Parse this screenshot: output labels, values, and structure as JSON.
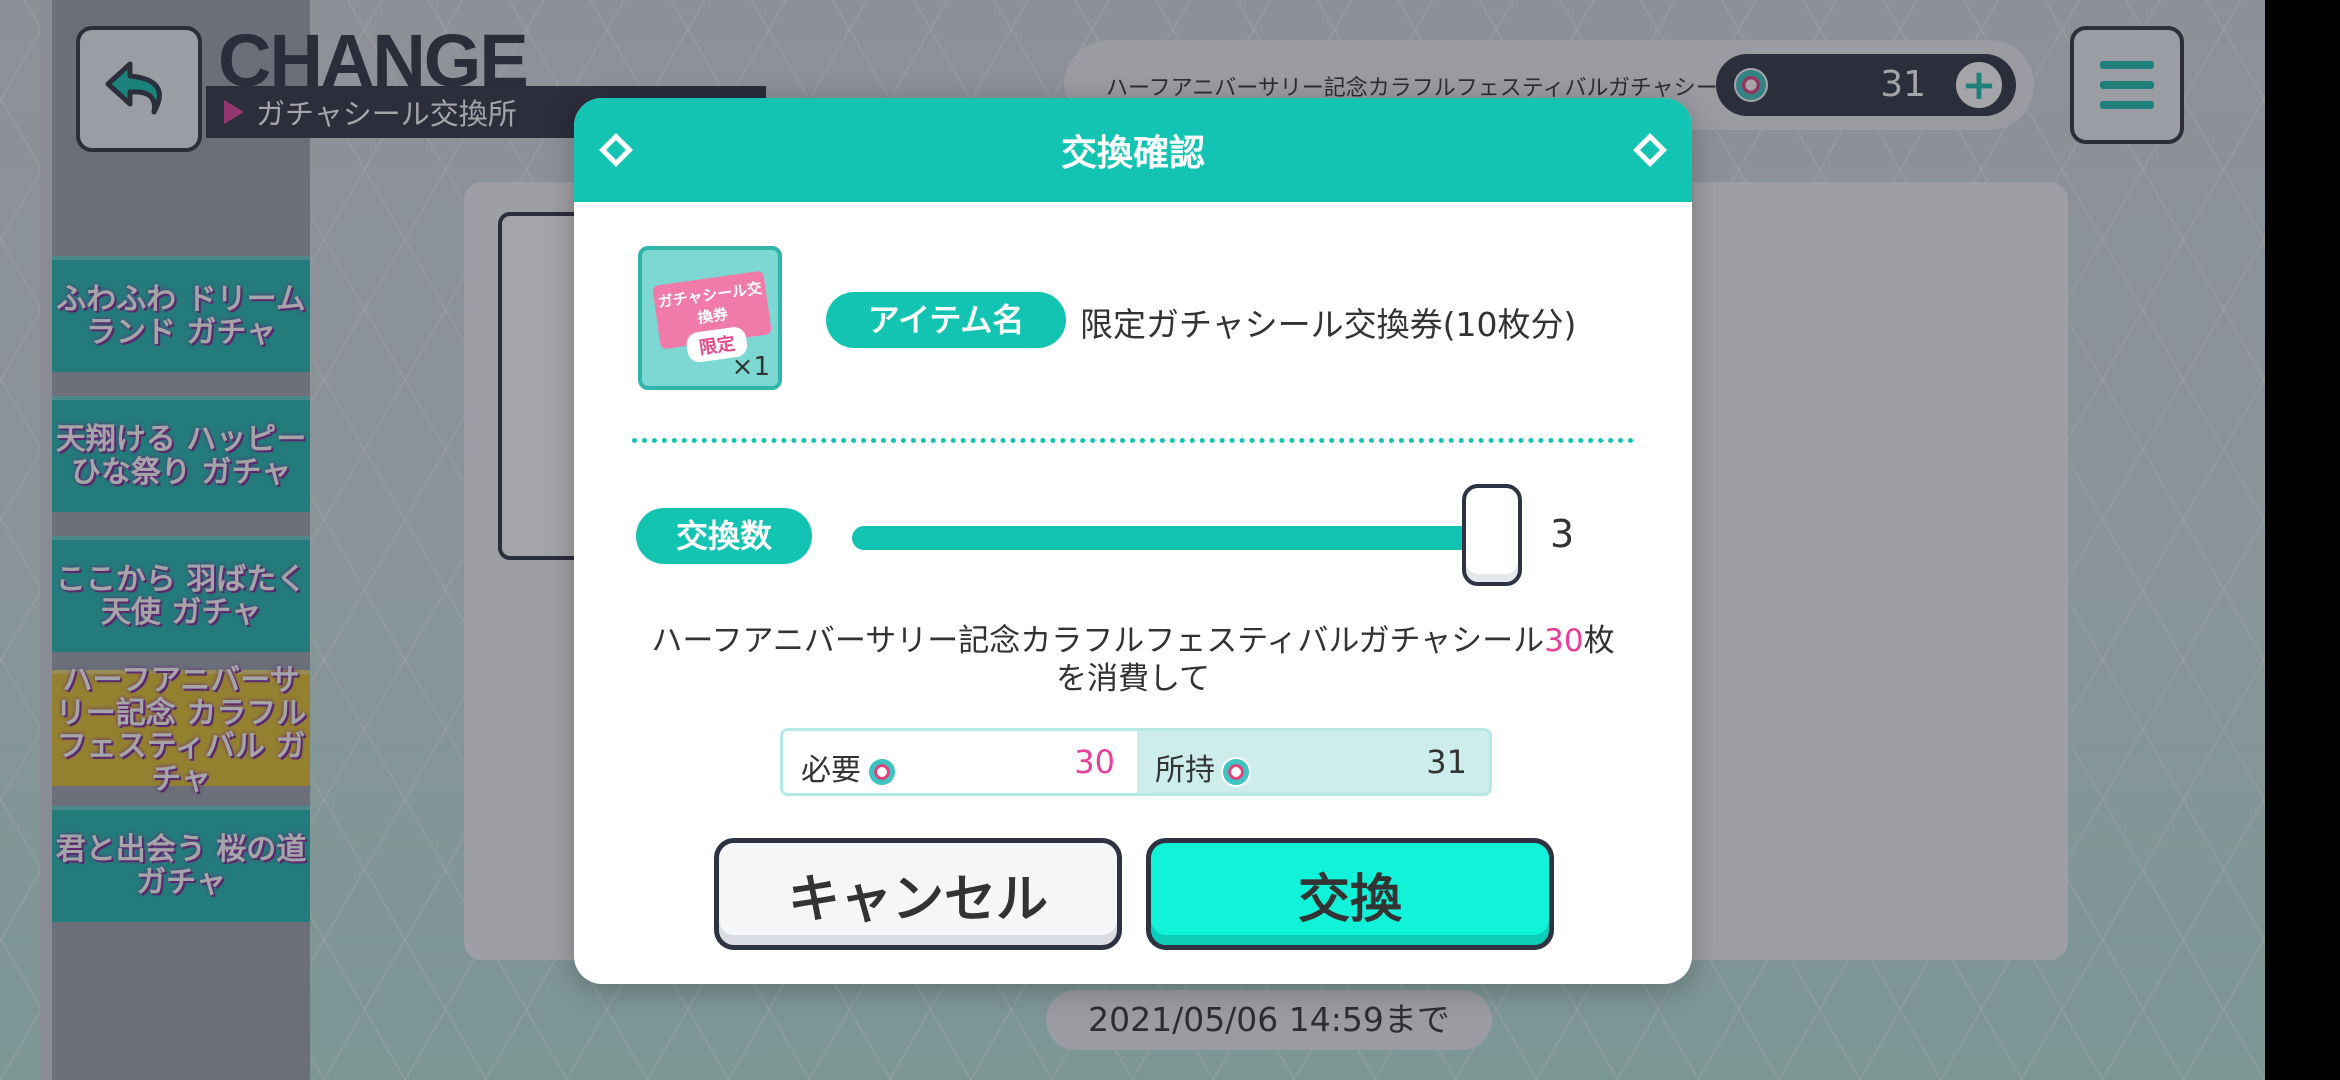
{
  "header": {
    "title": "CHANGE",
    "subtitle": "ガチャシール交換所",
    "currency_name": "ハーフアニバーサリー記念カラフルフェスティバルガチャシール",
    "currency_count": "31",
    "plus_label": "+"
  },
  "sidebar": {
    "banners": [
      {
        "label": "ふわふわ ドリームランド ガチャ",
        "color": "#1fb8b0"
      },
      {
        "label": "天翔ける ハッピーひな祭り ガチャ",
        "color": "#1fb8b0"
      },
      {
        "label": "ここから 羽ばたく天使 ガチャ",
        "color": "#1fb8b0"
      },
      {
        "label": "ハーフアニバーサリー記念 カラフル フェスティバル ガチャ",
        "color": "#e2c230"
      },
      {
        "label": "君と出会う 桜の道 ガチャ",
        "color": "#1fb8b0"
      }
    ]
  },
  "deadline": "2021/05/06 14:59まで",
  "dialog": {
    "title": "交換確認",
    "item": {
      "thumb_ticket_text": "ガチャシール交換券",
      "thumb_badge": "限定",
      "quantity": "×1",
      "name_label": "アイテム名",
      "name": "限定ガチャシール交換券(10枚分)"
    },
    "exchange": {
      "label": "交換数",
      "value": "3",
      "max": 3
    },
    "description": {
      "before": "ハーフアニバーサリー記念カラフルフェスティバルガチャシール",
      "amount": "30",
      "after": "枚",
      "line2": "を消費して"
    },
    "cost": {
      "required_label": "必要",
      "required_value": "30",
      "owned_label": "所持",
      "owned_value": "31"
    },
    "buttons": {
      "cancel": "キャンセル",
      "ok": "交換"
    }
  },
  "colors": {
    "accent": "#14c4b2",
    "highlight": "#e6409a",
    "dark": "#2d3342"
  }
}
